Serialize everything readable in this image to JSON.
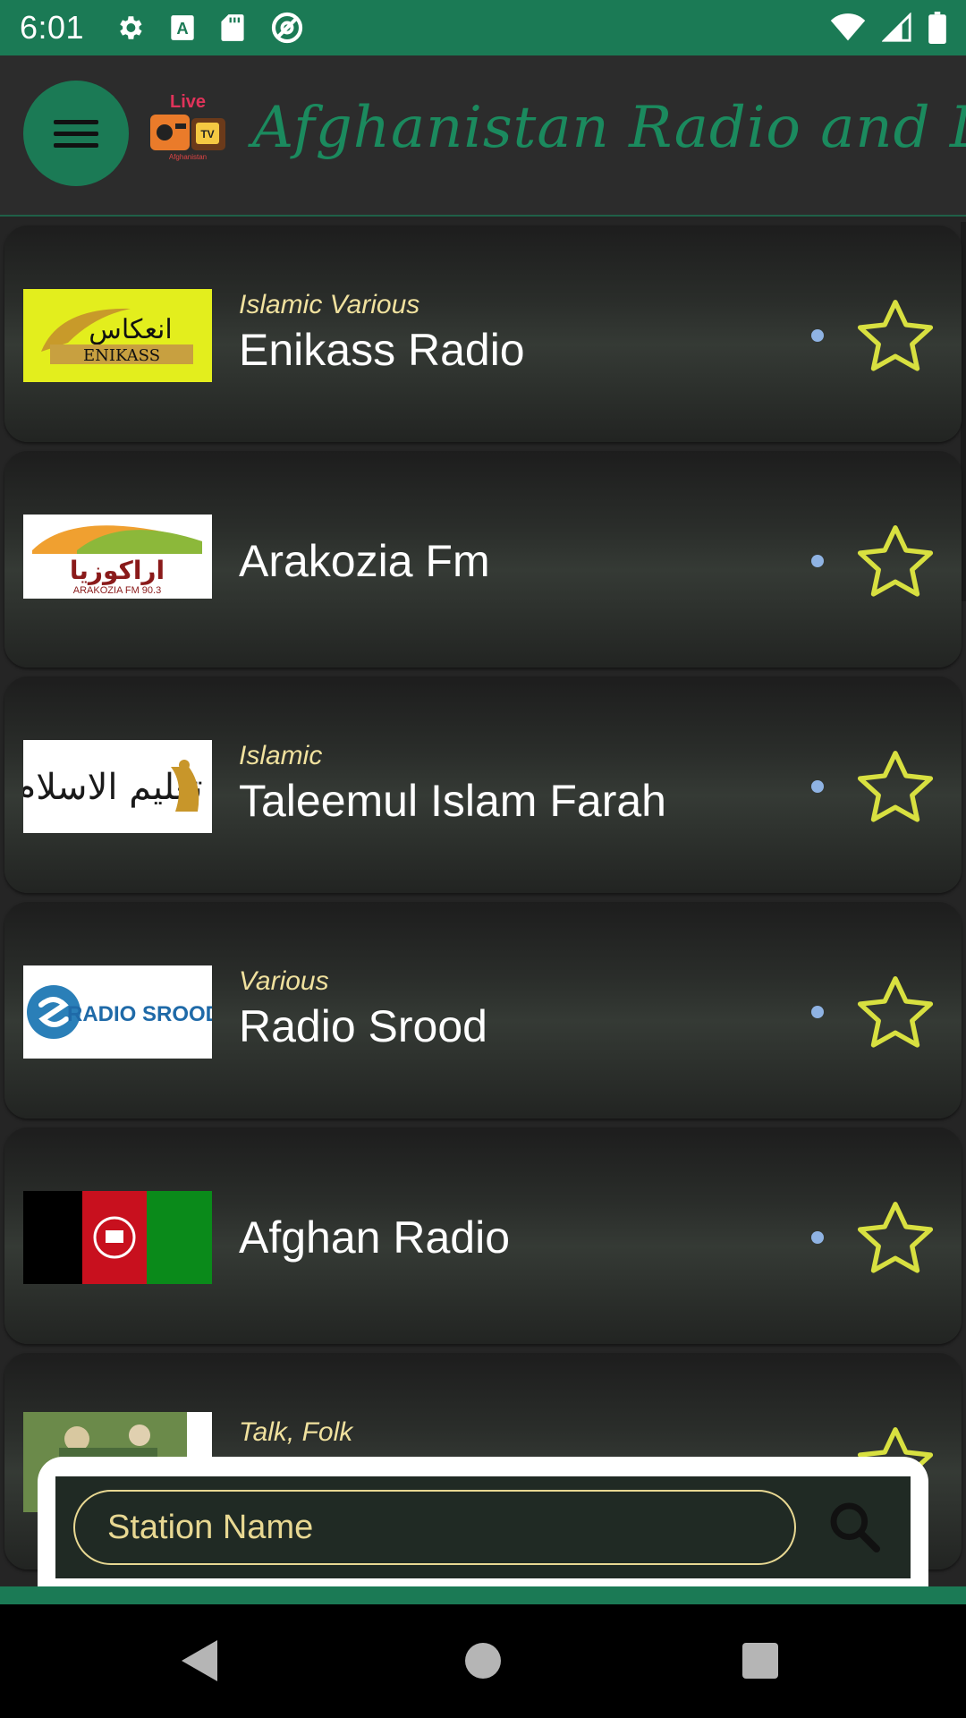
{
  "status_bar": {
    "time": "6:01",
    "left_icons": [
      "settings-icon",
      "text-a-icon",
      "sd-card-icon",
      "no-disturb-icon"
    ],
    "right_icons": [
      "wifi-icon",
      "cell-signal-icon",
      "battery-icon"
    ]
  },
  "toolbar": {
    "title": "Afghanistan Radio and Live TV",
    "logo_text": "Live",
    "logo_sub": "Afghanistan"
  },
  "stations": [
    {
      "genre": "Islamic Various",
      "name": "Enikass Radio",
      "logo_text": "ENIKASS"
    },
    {
      "genre": "",
      "name": "Arakozia Fm",
      "logo_text": "ARAKOZIA FM 90.3"
    },
    {
      "genre": "Islamic",
      "name": "Taleemul Islam Farah",
      "logo_text": ""
    },
    {
      "genre": "Various",
      "name": "Radio Srood",
      "logo_text": "RADIO SROOD"
    },
    {
      "genre": "",
      "name": "Afghan Radio",
      "logo_text": ""
    },
    {
      "genre": "Talk, Folk",
      "name": "",
      "logo_text": ""
    }
  ],
  "search": {
    "placeholder": "Station Name"
  },
  "colors": {
    "accent": "#1b7a55",
    "genre_text": "#f0e19e",
    "star": "#d8e040",
    "dot": "#8fb3e3"
  }
}
